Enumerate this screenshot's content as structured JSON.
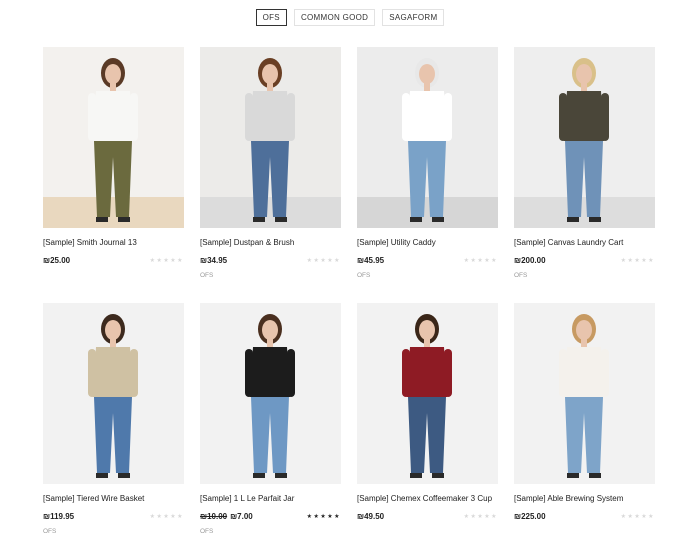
{
  "filters": [
    {
      "label": "OFS",
      "active": true
    },
    {
      "label": "COMMON GOOD",
      "active": false
    },
    {
      "label": "SAGAFORM",
      "active": false
    }
  ],
  "products": [
    {
      "title": "[Sample] Smith Journal 13",
      "price": "₪25.00",
      "old_price": "",
      "stars": "★★★★★",
      "rating": 0,
      "brand": "",
      "bg": "#f3f1ee",
      "floor": "#e9d8bf",
      "top": "#f7f7f5",
      "bottom": "#6b6a3e",
      "skin": "#e8c4ad",
      "hair": "#5a3a26"
    },
    {
      "title": "[Sample] Dustpan & Brush",
      "price": "₪34.95",
      "old_price": "",
      "stars": "★★★★★",
      "rating": 0,
      "brand": "OFS",
      "bg": "#ecebe9",
      "floor": "#dcdcdc",
      "top": "#d9d9d9",
      "bottom": "#4e6f9a",
      "skin": "#e8c4ad",
      "hair": "#6a3f24"
    },
    {
      "title": "[Sample] Utility Caddy",
      "price": "₪45.95",
      "old_price": "",
      "stars": "★★★★★",
      "rating": 0,
      "brand": "OFS",
      "bg": "#ececec",
      "floor": "#d6d6d6",
      "top": "#ffffff",
      "bottom": "#7aa2c8",
      "skin": "#e8c4ad",
      "hair": "#e8e8e8"
    },
    {
      "title": "[Sample] Canvas Laundry Cart",
      "price": "₪200.00",
      "old_price": "",
      "stars": "★★★★★",
      "rating": 0,
      "brand": "OFS",
      "bg": "#eeeeee",
      "floor": "#dddddd",
      "top": "#4a4639",
      "bottom": "#6f92b8",
      "skin": "#e8c4ad",
      "hair": "#d9c089"
    },
    {
      "title": "[Sample] Tiered Wire Basket",
      "price": "₪119.95",
      "old_price": "",
      "stars": "★★★★★",
      "rating": 0,
      "brand": "OFS",
      "bg": "#f2f2f2",
      "floor": "#f2f2f2",
      "top": "#cfc1a3",
      "bottom": "#4f79ab",
      "skin": "#e8c4ad",
      "hair": "#3d2a1e"
    },
    {
      "title": "[Sample] 1 L Le Parfait Jar",
      "price": "₪7.00",
      "old_price": "₪10.00",
      "stars": "★★★★★",
      "rating": 5,
      "brand": "OFS",
      "bg": "#f2f2f2",
      "floor": "#f2f2f2",
      "top": "#1c1c1c",
      "bottom": "#6e98c4",
      "skin": "#e8c4ad",
      "hair": "#4a2f1f"
    },
    {
      "title": "[Sample] Chemex Coffeemaker 3 Cup",
      "price": "₪49.50",
      "old_price": "",
      "stars": "★★★★★",
      "rating": 0,
      "brand": "",
      "bg": "#f2f2f2",
      "floor": "#f2f2f2",
      "top": "#8e1b24",
      "bottom": "#3d5a82",
      "skin": "#e8c4ad",
      "hair": "#3a2618"
    },
    {
      "title": "[Sample] Able Brewing System",
      "price": "₪225.00",
      "old_price": "",
      "stars": "★★★★★",
      "rating": 0,
      "brand": "",
      "bg": "#f2f2f2",
      "floor": "#f2f2f2",
      "top": "#f4f1ec",
      "bottom": "#7ea4c9",
      "skin": "#e8c4ad",
      "hair": "#c79a62"
    }
  ]
}
